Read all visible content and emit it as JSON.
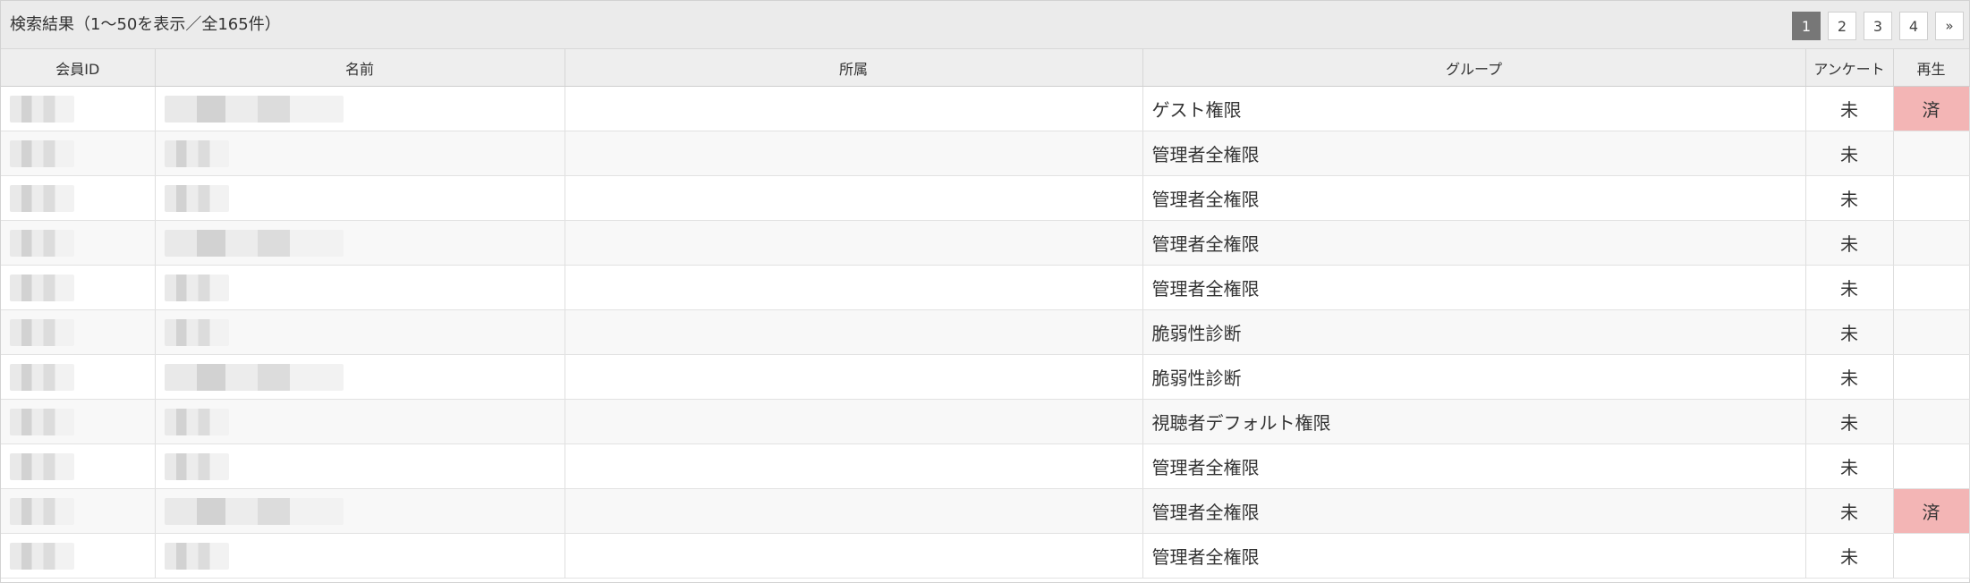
{
  "header": {
    "summary": "検索結果（1〜50を表示／全165件）",
    "pages": [
      "1",
      "2",
      "3",
      "4"
    ],
    "current_page": "1",
    "next_label": "»"
  },
  "columns": {
    "member_id": "会員ID",
    "name": "名前",
    "affiliation": "所属",
    "group": "グループ",
    "survey": "アンケート",
    "played": "再生"
  },
  "rows": [
    {
      "group": "ゲスト権限",
      "survey": "未",
      "played": "済"
    },
    {
      "group": "管理者全権限",
      "survey": "未",
      "played": ""
    },
    {
      "group": "管理者全権限",
      "survey": "未",
      "played": ""
    },
    {
      "group": "管理者全権限",
      "survey": "未",
      "played": ""
    },
    {
      "group": "管理者全権限",
      "survey": "未",
      "played": ""
    },
    {
      "group": "脆弱性診断",
      "survey": "未",
      "played": ""
    },
    {
      "group": "脆弱性診断",
      "survey": "未",
      "played": ""
    },
    {
      "group": "視聴者デフォルト権限",
      "survey": "未",
      "played": ""
    },
    {
      "group": "管理者全権限",
      "survey": "未",
      "played": ""
    },
    {
      "group": "管理者全権限",
      "survey": "未",
      "played": "済"
    },
    {
      "group": "管理者全権限",
      "survey": "未",
      "played": ""
    }
  ],
  "colors": {
    "played_highlight": "#f3b5b5",
    "active_page": "#777777"
  }
}
